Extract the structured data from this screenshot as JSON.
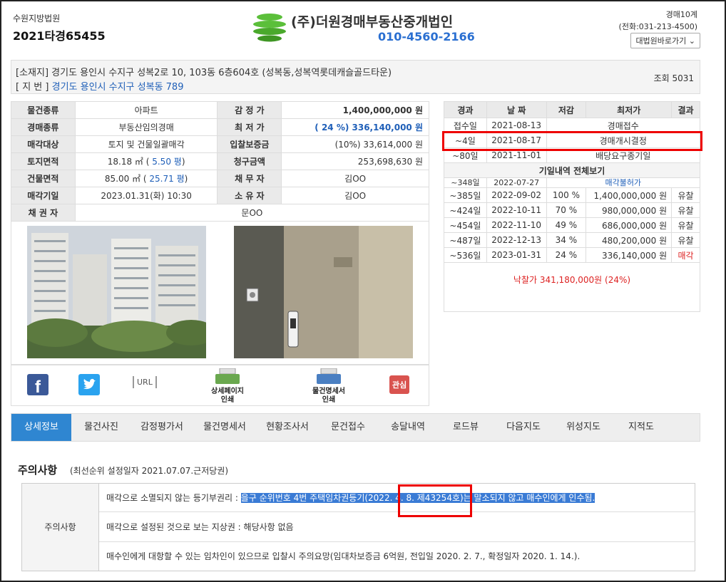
{
  "header": {
    "court_name": "수원지방법원",
    "case_no": "2021타경65455",
    "company_name": "(주)더원경매부동산중개법인",
    "company_phone": "010-4560-2166",
    "division": "경매10계",
    "court_phone": "(전화:031-213-4500)",
    "court_select": "대법원바로가기 ⌄"
  },
  "address": {
    "location_label": "[소재지]",
    "location": "경기도 용인시 수지구 성복2로 10, 103동 6층604호 (성복동,성복역롯데캐슬골드타운)",
    "jibun_label": "[ 지 번 ]",
    "jibun": "경기도 용인시 수지구 성복동 789",
    "views": "조회 5031"
  },
  "info": {
    "type_label": "물건종류",
    "type": "아파트",
    "appraisal_label": "감 정 가",
    "appraisal": "1,400,000,000 원",
    "auction_type_label": "경매종류",
    "auction_type": "부동산임의경매",
    "min_price_label": "최 저 가",
    "min_price": "( 24 %) 336,140,000 원",
    "target_label": "매각대상",
    "target": "토지 및 건물일괄매각",
    "deposit_label": "입찰보증금",
    "deposit": "(10%) 33,614,000 원",
    "land_label": "토지면적",
    "land_m2": "18.18 ㎡ (",
    "land_py": " 5.50 평",
    "land_close": ")",
    "claim_label": "청구금액",
    "claim": "253,698,630 원",
    "building_label": "건물면적",
    "building_m2": "85.00 ㎡ (",
    "building_py": " 25.71 평",
    "building_close": ")",
    "debtor_label": "채 무 자",
    "debtor": "김OO",
    "sale_date_label": "매각기일",
    "sale_date": "2023.01.31(화) 10:30",
    "owner_label": "소 유 자",
    "owner": "김OO",
    "creditor_label": "채 권 자",
    "creditor": "문OO"
  },
  "icons": {
    "url_label": "URL",
    "detail_print": "상세페이지\n인쇄",
    "item_print": "물건명세서\n인쇄",
    "interest": "관심"
  },
  "schedule": {
    "headers": [
      "경과",
      "날 짜",
      "저감",
      "최저가",
      "결과"
    ],
    "top_rows": [
      {
        "elapsed": "접수일",
        "date": "2021-08-13",
        "note": "경매접수"
      },
      {
        "elapsed": "~4일",
        "date": "2021-08-17",
        "note": "경매개시결정"
      },
      {
        "elapsed": "~80일",
        "date": "2021-11-01",
        "note": "배당요구종기일"
      }
    ],
    "all_view": "기일내역 전체보기",
    "partial_row": {
      "elapsed": "~348일",
      "date": "2022-07-27",
      "note": "매각불허가"
    },
    "rows": [
      {
        "elapsed": "~385일",
        "date": "2022-09-02",
        "rate": "100 %",
        "price": "1,400,000,000 원",
        "result": "유찰"
      },
      {
        "elapsed": "~424일",
        "date": "2022-10-11",
        "rate": "70 %",
        "price": "980,000,000 원",
        "result": "유찰"
      },
      {
        "elapsed": "~454일",
        "date": "2022-11-10",
        "rate": "49 %",
        "price": "686,000,000 원",
        "result": "유찰"
      },
      {
        "elapsed": "~487일",
        "date": "2022-12-13",
        "rate": "34 %",
        "price": "480,200,000 원",
        "result": "유찰"
      },
      {
        "elapsed": "~536일",
        "date": "2023-01-31",
        "rate": "24 %",
        "price": "336,140,000 원",
        "result": "매각"
      }
    ],
    "sold_price": "낙찰가 341,180,000원 (24%)"
  },
  "tabs": [
    "상세정보",
    "물건사진",
    "감정평가서",
    "물건명세서",
    "현황조사서",
    "문건접수",
    "송달내역",
    "로드뷰",
    "다음지도",
    "위성지도",
    "지적도"
  ],
  "notes": {
    "title": "주의사항",
    "subtitle": "(최선순위 설정일자 2021.07.07.근저당권)",
    "header": "주의사항",
    "row1_prefix": "매각으로 소멸되지 않는 등기부권리 : ",
    "row1_selected": "을구 순위번호 4번 주택임차권등기(2022. 4. 8. 제43254호)는 말소되지 않고 매수인에게 인수됨.",
    "row2": "매각으로 설정된 것으로 보는 지상권 : 해당사항 없음",
    "row3": "매수인에게 대항할 수 있는 임차인이 있으므로 입찰시 주의요망(임대차보증금 6억원, 전입일 2020. 2. 7., 확정일자 2020. 1. 14.)."
  },
  "colors": {
    "accent": "#2f86d1",
    "link": "#1f5fb8",
    "alert": "#dd2222",
    "highlight_box": "#ee0000"
  }
}
